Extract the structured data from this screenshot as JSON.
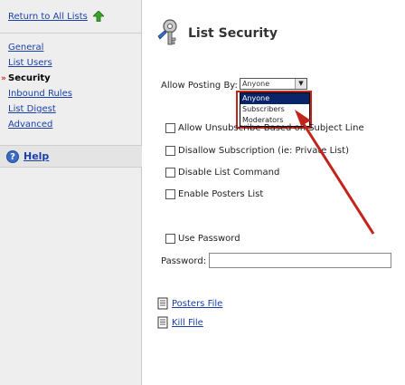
{
  "sidebar": {
    "return_label": "Return to All Lists",
    "items": [
      {
        "label": "General",
        "active": false
      },
      {
        "label": "List Users",
        "active": false
      },
      {
        "label": "Security",
        "active": true
      },
      {
        "label": "Inbound Rules",
        "active": false
      },
      {
        "label": "List Digest",
        "active": false
      },
      {
        "label": "Advanced",
        "active": false
      }
    ],
    "active_marker": "»",
    "help_label": "Help"
  },
  "main": {
    "title": "List Security",
    "allow_posting_label": "Allow Posting By:",
    "allow_posting_value": "Anyone",
    "allow_posting_options": [
      "Anyone",
      "Subscribers",
      "Moderators"
    ],
    "checkboxes": [
      {
        "label": "Allow Unsubscribe Based on Subject Line",
        "checked": false
      },
      {
        "label": "Disallow Subscription (ie: Private List)",
        "checked": false
      },
      {
        "label": "Disable List Command",
        "checked": false
      },
      {
        "label": "Enable Posters List",
        "checked": false
      },
      {
        "label": "Use Password",
        "checked": false
      }
    ],
    "password_label": "Password:",
    "password_value": "",
    "file_links": [
      "Posters File",
      "Kill File"
    ]
  },
  "colors": {
    "link": "#1a3fa8",
    "annotation": "#c2241c",
    "selected_option": "#0a246a",
    "sidebar_bg": "#eeeeee"
  },
  "icons": {
    "return": "green-up-arrow-icon",
    "title": "security-key-icon",
    "help": "help-icon",
    "files": "document-icon"
  }
}
